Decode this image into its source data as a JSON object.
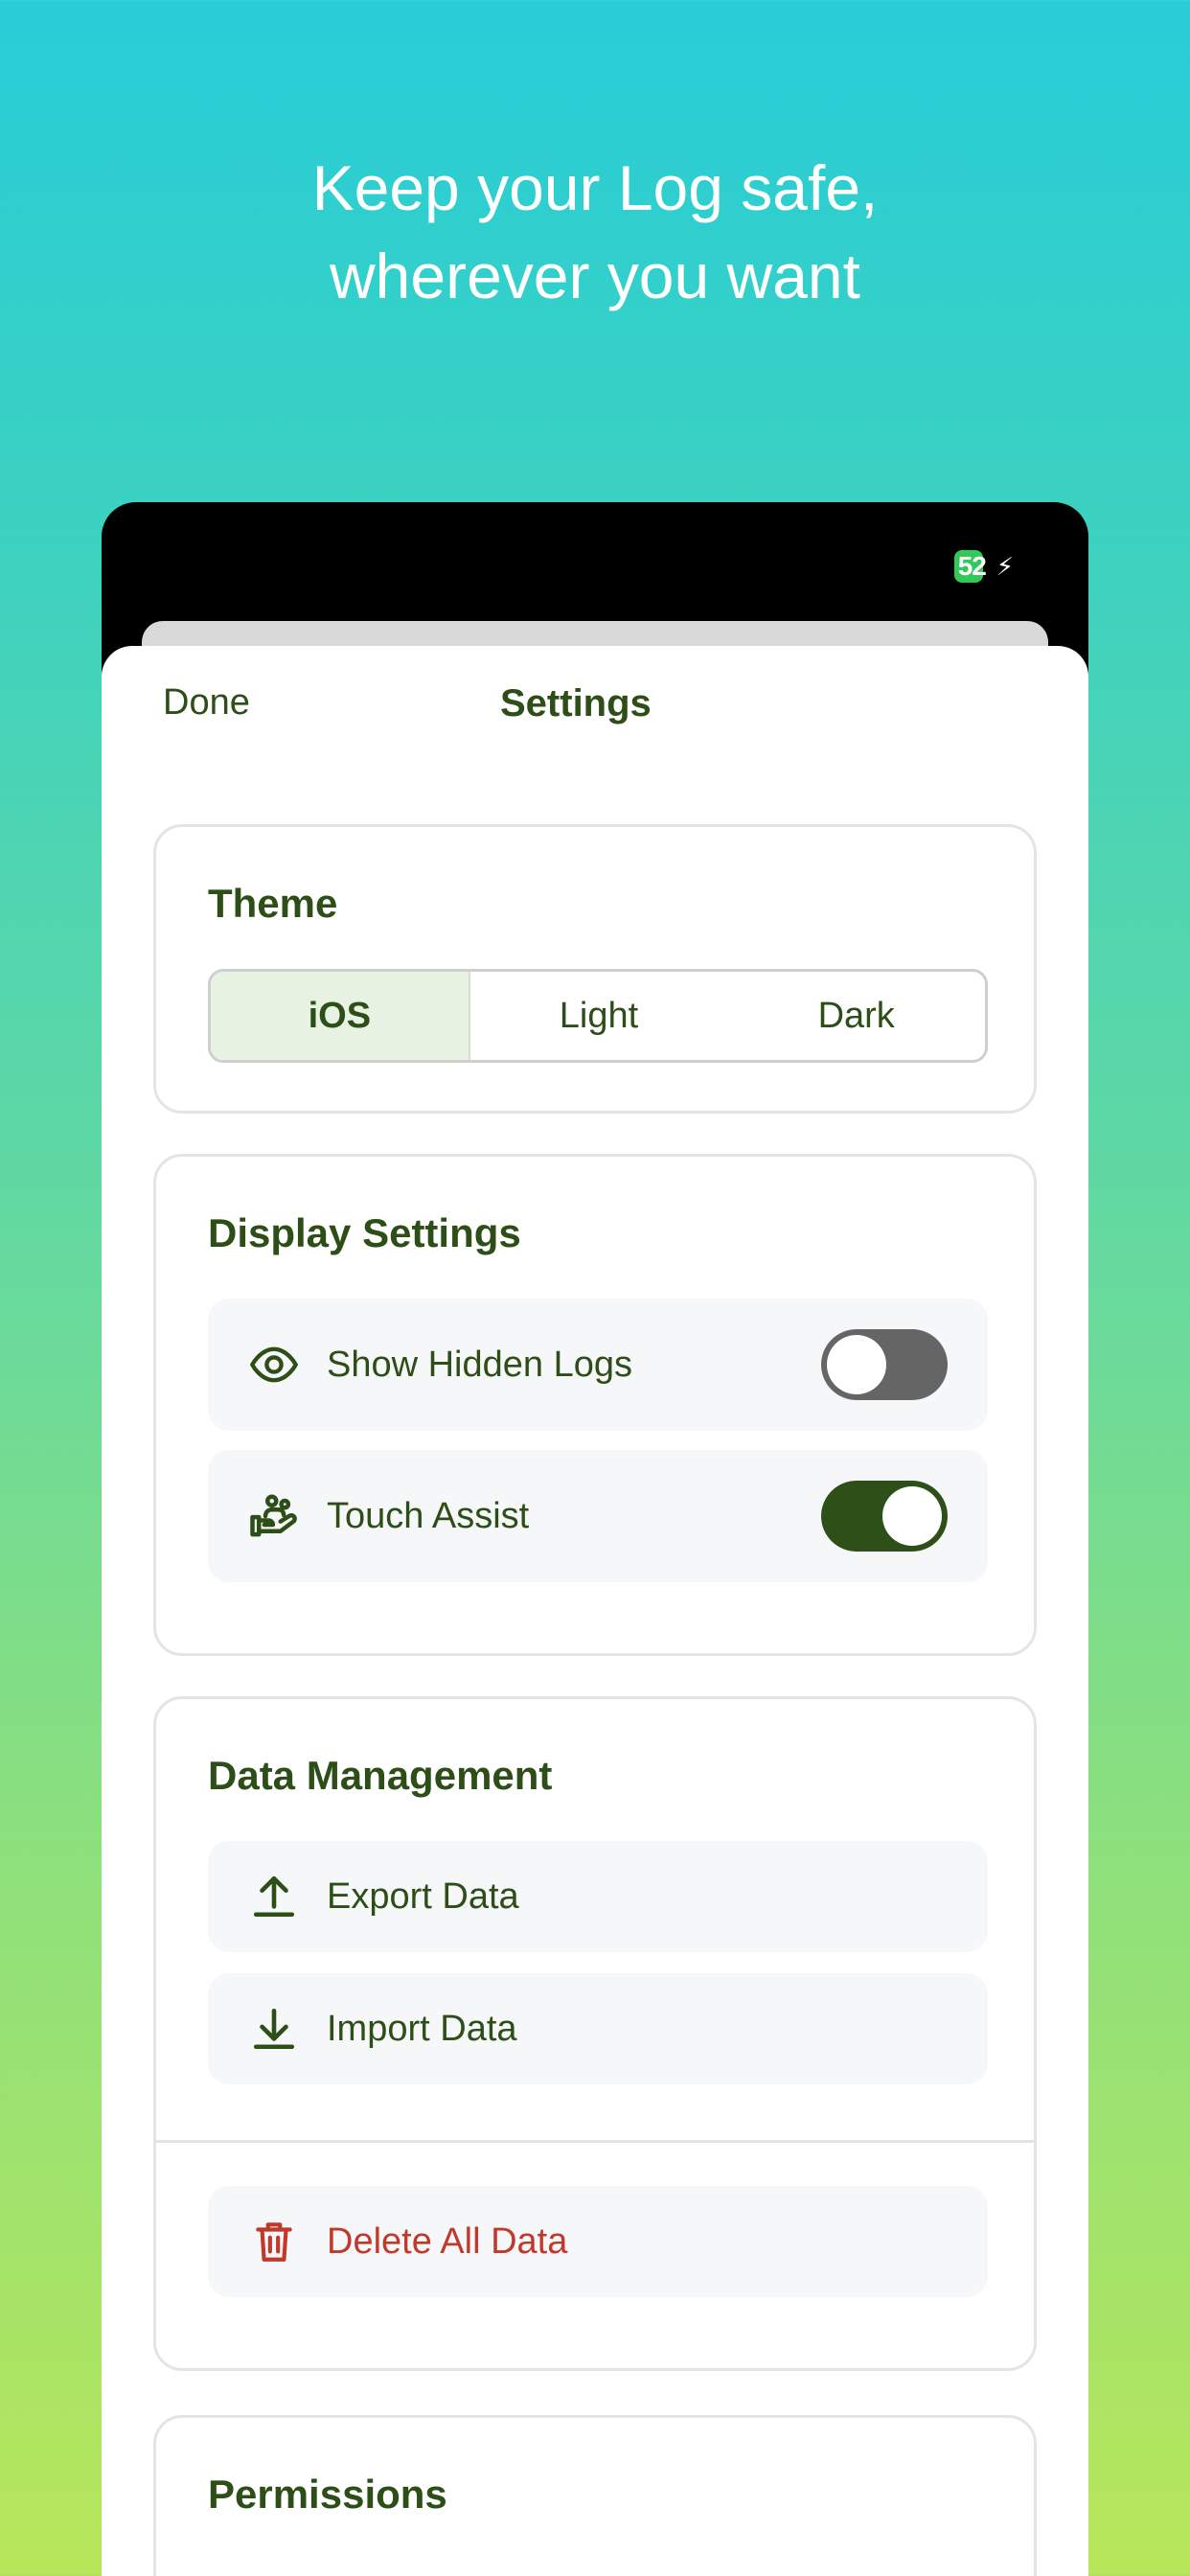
{
  "headline": {
    "line1": "Keep your Log safe,",
    "line2": "wherever you want"
  },
  "status_bar": {
    "battery_level": "52",
    "charging_icon": "bolt-icon",
    "battery_color": "#34c759"
  },
  "nav": {
    "done_label": "Done",
    "title": "Settings"
  },
  "theme": {
    "title": "Theme",
    "options": [
      "iOS",
      "Light",
      "Dark"
    ],
    "selected": "iOS"
  },
  "display_settings": {
    "title": "Display Settings",
    "items": [
      {
        "label": "Show Hidden Logs",
        "icon": "eye-icon",
        "enabled": false
      },
      {
        "label": "Touch Assist",
        "icon": "hand-assist-icon",
        "enabled": true
      }
    ]
  },
  "data_management": {
    "title": "Data Management",
    "export_label": "Export Data",
    "export_icon": "upload-icon",
    "import_label": "Import Data",
    "import_icon": "download-icon",
    "delete_label": "Delete All Data",
    "delete_icon": "trash-icon",
    "danger_color": "#c0392b"
  },
  "permissions": {
    "title": "Permissions"
  },
  "colors": {
    "primary_text": "#2d4e17",
    "toggle_on": "#2e5018",
    "toggle_off": "#656565",
    "segment_active": "#e7f2e3"
  }
}
